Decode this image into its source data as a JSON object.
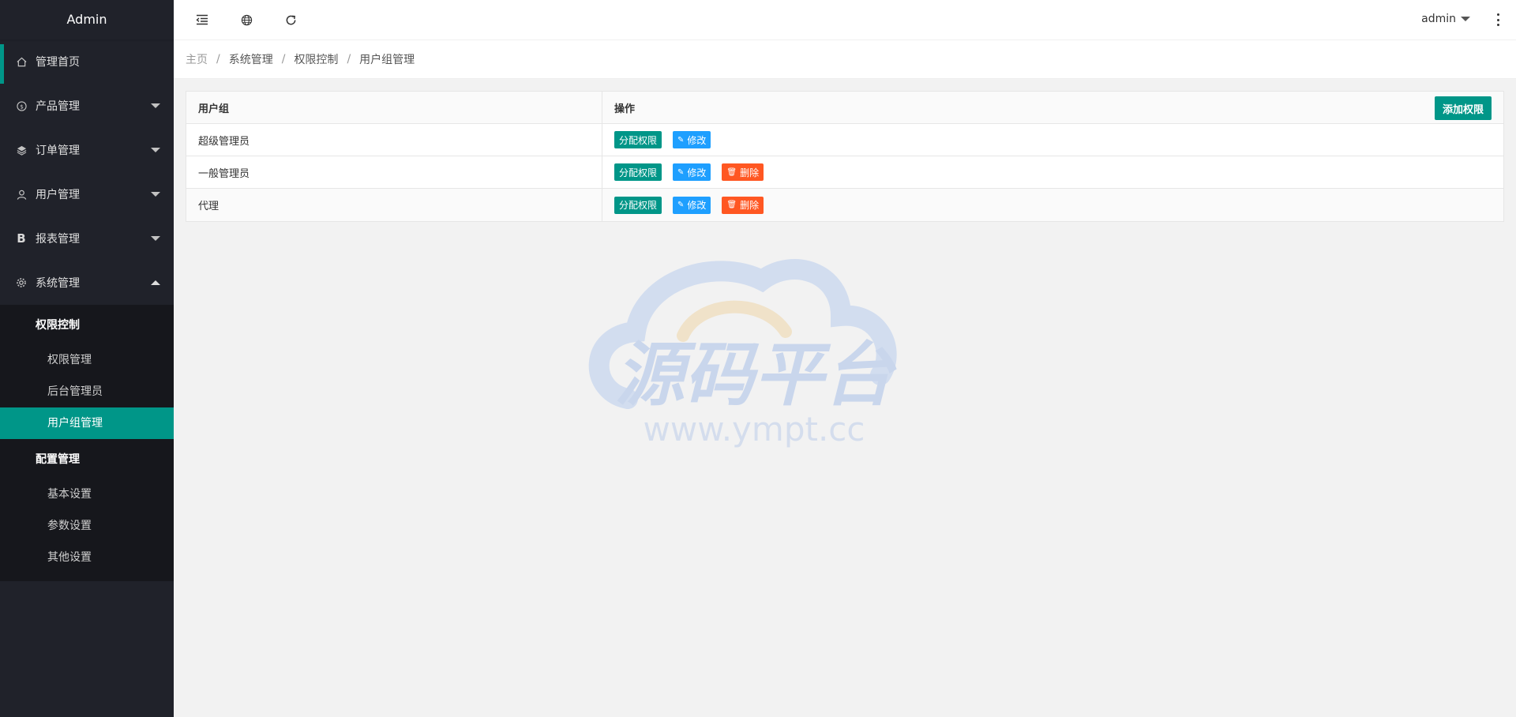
{
  "app": {
    "title": "Admin"
  },
  "sidebar": {
    "items": [
      {
        "label": "管理首页",
        "icon": "home-icon"
      },
      {
        "label": "产品管理",
        "icon": "dollar-icon"
      },
      {
        "label": "订单管理",
        "icon": "layers-icon"
      },
      {
        "label": "用户管理",
        "icon": "user-icon"
      },
      {
        "label": "报表管理",
        "icon": "b-icon"
      },
      {
        "label": "系统管理",
        "icon": "gear-icon"
      }
    ],
    "groups": [
      {
        "label": "权限控制",
        "children": [
          "权限管理",
          "后台管理员",
          "用户组管理"
        ]
      },
      {
        "label": "配置管理",
        "children": [
          "基本设置",
          "参数设置",
          "其他设置"
        ]
      }
    ],
    "active": "用户组管理"
  },
  "header": {
    "user": "admin"
  },
  "breadcrumb": [
    "主页",
    "系统管理",
    "权限控制",
    "用户组管理"
  ],
  "breadcrumb_sep": "/",
  "table": {
    "columns": [
      "用户组",
      "操作"
    ],
    "add_button": "添加权限",
    "rows": [
      {
        "name": "超级管理员"
      },
      {
        "name": "一般管理员"
      },
      {
        "name": "代理"
      }
    ],
    "actions": {
      "assign": "分配权限",
      "edit": "修改",
      "delete": "删除"
    }
  },
  "watermark": {
    "title": "源码平台",
    "url": "www.ympt.cc"
  },
  "colors": {
    "sidebar": "#20222a",
    "accent": "#009688",
    "edit": "#1e9fff",
    "danger": "#ff5722"
  }
}
